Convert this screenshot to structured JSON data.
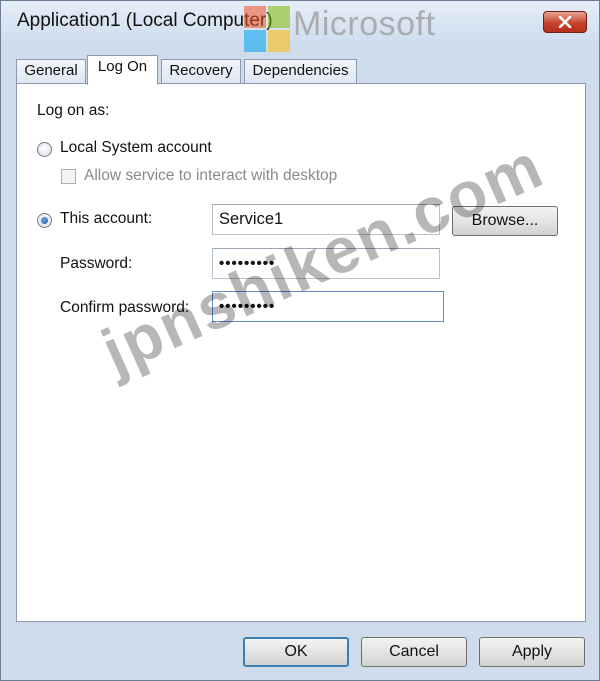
{
  "window": {
    "title": "Application1 (Local Computer)"
  },
  "watermarks": {
    "top": "Microsoft",
    "diagonal": "jpnshiken.com"
  },
  "tabs": [
    {
      "label": "General"
    },
    {
      "label": "Log On",
      "active": true
    },
    {
      "label": "Recovery"
    },
    {
      "label": "Dependencies"
    }
  ],
  "logon": {
    "heading": "Log on as:",
    "local_system_label": "Local System account",
    "local_system_selected": false,
    "interact_label": "Allow service to interact with desktop",
    "interact_checked": false,
    "this_account_label": "This account:",
    "this_account_selected": true,
    "account_value": "Service1",
    "browse_label": "Browse...",
    "password_label": "Password:",
    "password_value": "•••••••••",
    "confirm_label": "Confirm password:",
    "confirm_value": "•••••••••"
  },
  "buttons": {
    "ok": "OK",
    "cancel": "Cancel",
    "apply": "Apply"
  },
  "colors": {
    "window_frame": "#cfdcec",
    "close_button": "#c7432b",
    "default_button_border": "#3c7fb1"
  }
}
